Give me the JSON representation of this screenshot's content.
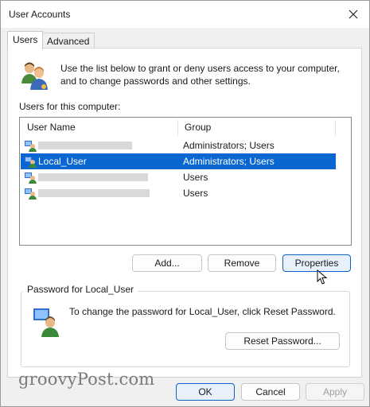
{
  "window": {
    "title": "User Accounts"
  },
  "tabs": [
    {
      "label": "Users",
      "active": true
    },
    {
      "label": "Advanced",
      "active": false
    }
  ],
  "intro": {
    "text": "Use the list below to grant or deny users access to your computer, and to change passwords and other settings."
  },
  "users_list": {
    "label": "Users for this computer:",
    "columns": [
      "User Name",
      "Group"
    ],
    "rows": [
      {
        "name": "",
        "group": "Administrators; Users",
        "selected": false,
        "redacted": true
      },
      {
        "name": "Local_User",
        "group": "Administrators; Users",
        "selected": true,
        "redacted": false
      },
      {
        "name": "",
        "group": "Users",
        "selected": false,
        "redacted": true
      },
      {
        "name": "",
        "group": "Users",
        "selected": false,
        "redacted": true
      }
    ]
  },
  "buttons": {
    "add": "Add...",
    "remove": "Remove",
    "properties": "Properties"
  },
  "password": {
    "group_label": "Password for Local_User",
    "text": "To change the password for Local_User, click Reset Password.",
    "reset_button": "Reset Password..."
  },
  "footer": {
    "ok": "OK",
    "cancel": "Cancel",
    "apply": "Apply"
  },
  "watermark": "groovyPost.com",
  "colors": {
    "selection": "#0a67d2",
    "default_button_border": "#0a64c8"
  },
  "icons": [
    "close-icon",
    "users-group-icon",
    "user-icon",
    "password-user-icon",
    "mouse-cursor-icon"
  ]
}
